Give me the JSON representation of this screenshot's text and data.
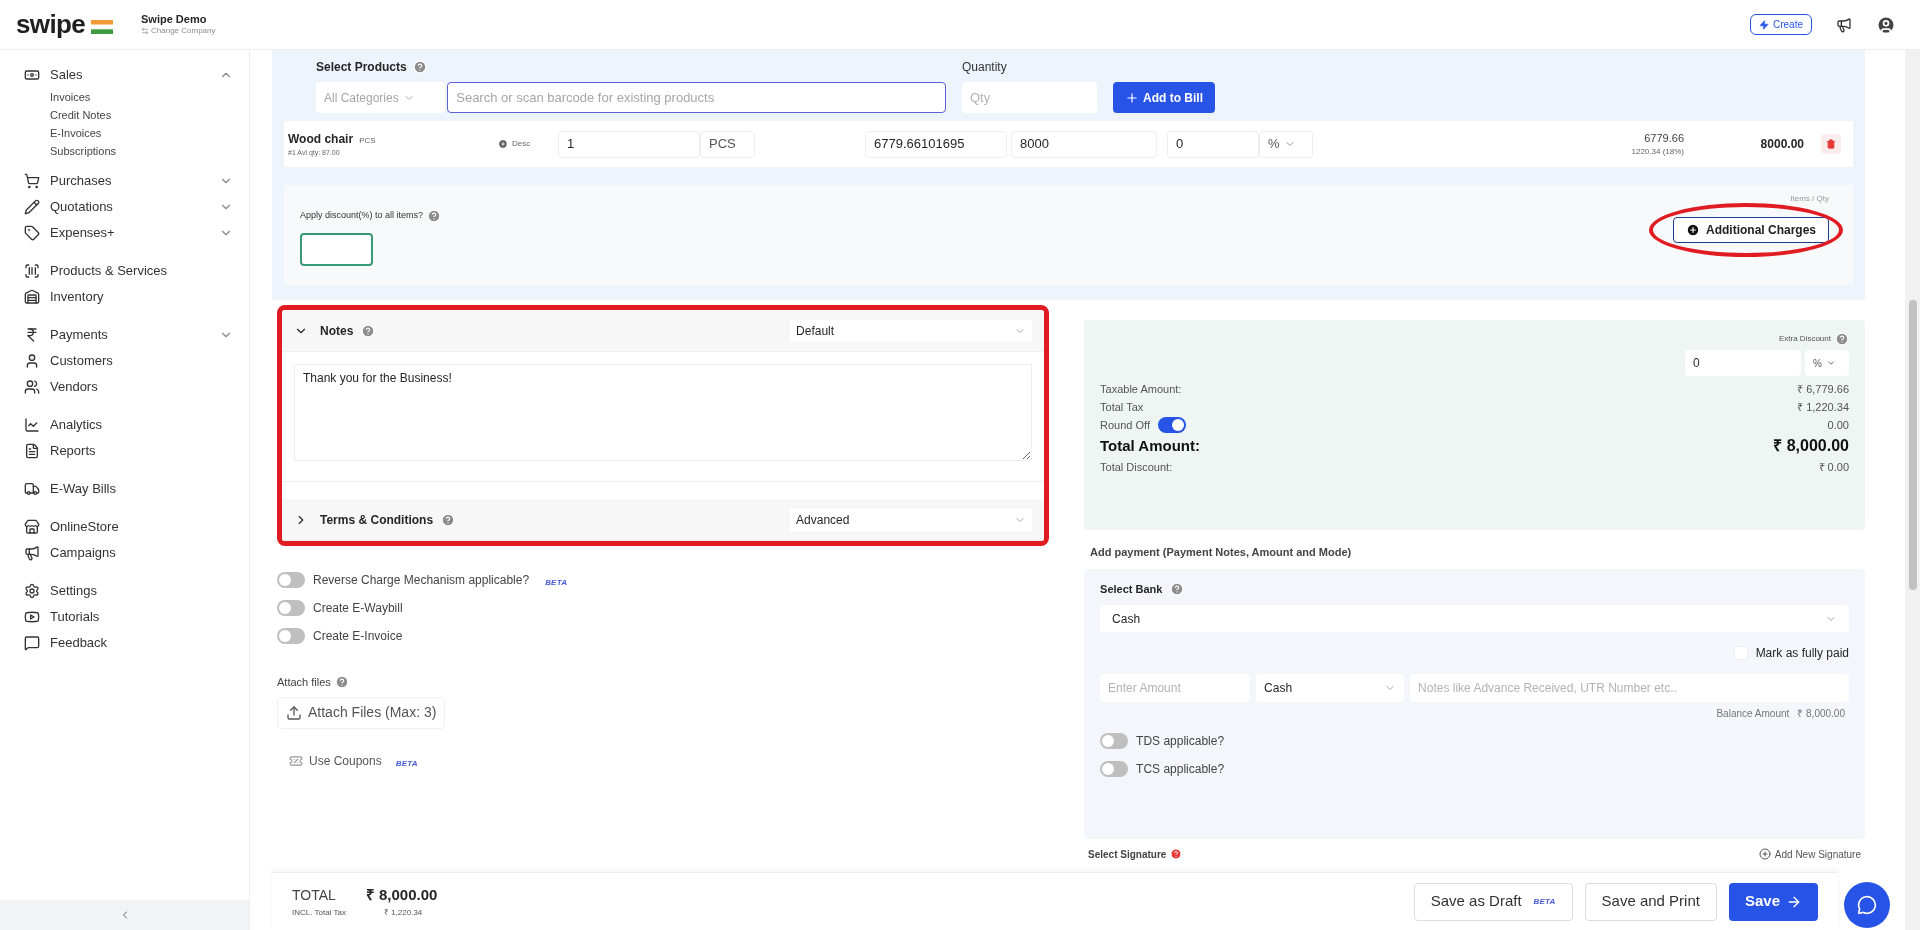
{
  "header": {
    "logo": "swipe",
    "company": "Swipe Demo",
    "change_company": "Change Company",
    "create_button": "Create"
  },
  "sidebar": {
    "groups": [
      [
        {
          "label": "Sales",
          "expanded": true,
          "children": [
            {
              "label": "Invoices"
            },
            {
              "label": "Credit Notes"
            },
            {
              "label": "E-Invoices"
            },
            {
              "label": "Subscriptions"
            }
          ]
        },
        {
          "label": "Purchases",
          "expanded": false
        },
        {
          "label": "Quotations",
          "expanded": false
        },
        {
          "label": "Expenses+",
          "expanded": false
        }
      ],
      [
        {
          "label": "Products & Services"
        },
        {
          "label": "Inventory"
        }
      ],
      [
        {
          "label": "Payments",
          "expanded": false
        },
        {
          "label": "Customers"
        },
        {
          "label": "Vendors"
        }
      ],
      [
        {
          "label": "Analytics"
        },
        {
          "label": "Reports"
        }
      ],
      [
        {
          "label": "E-Way Bills"
        }
      ],
      [
        {
          "label": "OnlineStore"
        },
        {
          "label": "Campaigns"
        }
      ],
      [
        {
          "label": "Settings"
        },
        {
          "label": "Tutorials"
        },
        {
          "label": "Feedback"
        }
      ]
    ]
  },
  "products": {
    "select_label": "Select Products",
    "category": "All Categories",
    "search_placeholder": "Search or scan barcode for existing products",
    "quantity_label": "Quantity",
    "qty_placeholder": "Qty",
    "add_button": "Add to Bill",
    "items": [
      {
        "name": "Wood chair",
        "unit_tag": "PCS",
        "stock": "#1 Avl qty: 87.00",
        "desc": "Desc",
        "qty": "1",
        "unit": "PCS",
        "price": "6779.66101695",
        "price_with_tax": "8000",
        "discount": "0",
        "discount_type": "%",
        "net": "6779.66",
        "tax": "1220.34 (18%)",
        "total": "8000.00"
      }
    ],
    "discount_label": "Apply discount(%) to all items?",
    "items_qty": "Items / Qty",
    "additional_charges": "Additional Charges"
  },
  "notes": [
    {
      "title": "Notes",
      "expanded": true,
      "template": "Default",
      "text": "Thank you for the Business!"
    },
    {
      "title": "Terms & Conditions",
      "expanded": false,
      "template": "Advanced"
    }
  ],
  "options": [
    {
      "label": "Reverse Charge Mechanism applicable?",
      "badge": "BETA",
      "on": false
    },
    {
      "label": "Create E-Waybill",
      "on": false
    },
    {
      "label": "Create E-Invoice",
      "on": false
    }
  ],
  "attach": {
    "label": "Attach files",
    "button": "Attach Files (Max: 3)"
  },
  "coupons": {
    "label": "Use Coupons",
    "badge": "BETA"
  },
  "totals": {
    "extra_discount_label": "Extra Discount",
    "extra_discount": "0",
    "extra_discount_type": "%",
    "rows": [
      {
        "kind": "normal",
        "label": "Taxable Amount:",
        "value": "₹ 6,779.66"
      },
      {
        "kind": "normal",
        "label": "Total Tax",
        "value": "₹ 1,220.34"
      },
      {
        "kind": "toggle",
        "label": "Round Off",
        "on": true,
        "value": "0.00"
      },
      {
        "kind": "total",
        "label": "Total Amount:",
        "value": "₹ 8,000.00"
      },
      {
        "kind": "normal",
        "label": "Total Discount:",
        "value": "₹ 0.00"
      }
    ]
  },
  "payment": {
    "title": "Add payment (Payment Notes, Amount and Mode)",
    "bank_label": "Select Bank",
    "bank": "Cash",
    "mark_paid": "Mark as fully paid",
    "mark_paid_checked": false,
    "amount_placeholder": "Enter Amount",
    "mode": "Cash",
    "notes_placeholder": "Notes like Advance Received, UTR Number etc..",
    "balance_label": "Balance Amount",
    "balance": "₹ 8,000.00",
    "toggles": [
      {
        "label": "TDS applicable?",
        "on": false
      },
      {
        "label": "TCS applicable?",
        "on": false
      }
    ]
  },
  "signature": {
    "label": "Select Signature",
    "add": "Add New Signature"
  },
  "footer": {
    "total_label": "TOTAL",
    "total": "₹ 8,000.00",
    "tax_label": "INCL. Total Tax",
    "tax": "₹ 1,220.34",
    "buttons": [
      {
        "kind": "draft",
        "label": "Save as Draft",
        "badge": "BETA"
      },
      {
        "kind": "print",
        "label": "Save and Print"
      },
      {
        "kind": "save",
        "label": "Save"
      }
    ]
  }
}
